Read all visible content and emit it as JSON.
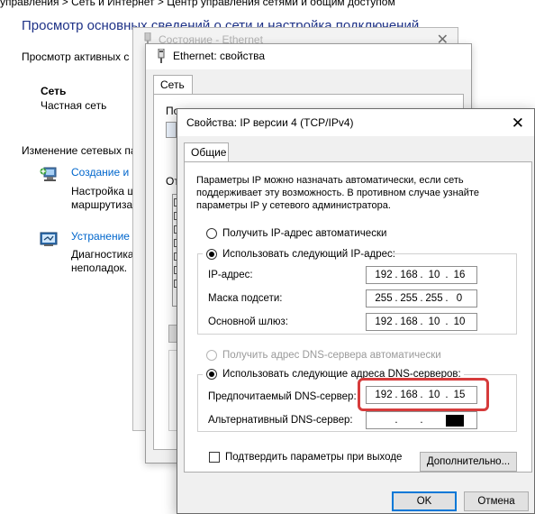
{
  "background": {
    "breadcrumb": "управления  >  Сеть и Интернет  >  Центр управления сетями и общим доступом",
    "heading": "Просмотр основных сведений о сети и настройка подключений",
    "subheading": "Просмотр активных с",
    "network_name": "Сеть",
    "network_type": "Частная сеть",
    "change_header": "Изменение сетевых па",
    "item1_link": "Создание и н",
    "item1_line1": "Настройка ш",
    "item1_line2": "маршрутиза",
    "item2_link": "Устранение",
    "item2_line1": "Диагностика",
    "item2_line2": "неполадок."
  },
  "status_window": {
    "title": "Состояние - Ethernet",
    "close_icon": "close-icon"
  },
  "ethernet_window": {
    "title": "Ethernet: свойства",
    "tab": "Сеть",
    "partial_label1": "По",
    "partial_label2": "От"
  },
  "ipv4_dialog": {
    "title": "Свойства: IP версии 4 (TCP/IPv4)",
    "tab_general": "Общие",
    "description": "Параметры IP можно назначать автоматически, если сеть поддерживает эту возможность. В противном случае узнайте параметры IP у сетевого администратора.",
    "radio_auto_ip": "Получить IP-адрес автоматически",
    "radio_manual_ip": "Использовать следующий IP-адрес:",
    "ip_label": "IP-адрес:",
    "ip_value": [
      "192",
      "168",
      "10",
      "16"
    ],
    "mask_label": "Маска подсети:",
    "mask_value": [
      "255",
      "255",
      "255",
      "0"
    ],
    "gateway_label": "Основной шлюз:",
    "gateway_value": [
      "192",
      "168",
      "10",
      "10"
    ],
    "radio_auto_dns": "Получить адрес DNS-сервера автоматически",
    "radio_manual_dns": "Использовать следующие адреса DNS-серверов:",
    "preferred_dns_label": "Предпочитаемый DNS-сервер:",
    "preferred_dns_value": [
      "192",
      "168",
      "10",
      "15"
    ],
    "alternate_dns_label": "Альтернативный DNS-сервер:",
    "alternate_dns_value": [
      "",
      "",
      "",
      ""
    ],
    "validate_checkbox": "Подтвердить параметры при выходе",
    "advanced_button": "Дополнительно...",
    "ok_button": "OK",
    "cancel_button": "Отмена"
  },
  "colors": {
    "highlight": "#d63b3b",
    "link": "#0066cc",
    "heading": "#1e3287"
  }
}
